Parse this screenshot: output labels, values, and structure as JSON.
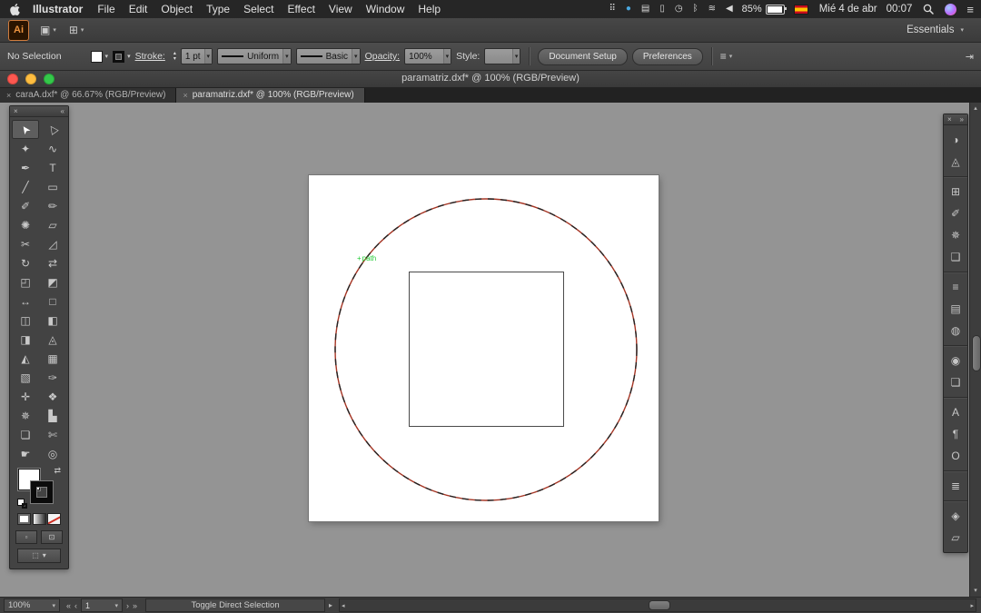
{
  "menubar": {
    "app_name": "Illustrator",
    "menus": [
      "File",
      "Edit",
      "Object",
      "Type",
      "Select",
      "Effect",
      "View",
      "Window",
      "Help"
    ],
    "status_icons": [
      {
        "name": "dropbox-icon",
        "glyph": "⠿"
      },
      {
        "name": "sync-icon",
        "glyph": "●",
        "color": "#4aa8e0"
      },
      {
        "name": "app-indicator-icon",
        "glyph": "▤"
      },
      {
        "name": "display-icon",
        "glyph": "▯"
      },
      {
        "name": "time-machine-icon",
        "glyph": "◷"
      },
      {
        "name": "bluetooth-icon",
        "glyph": "ᛒ"
      },
      {
        "name": "wifi-icon",
        "glyph": "≋"
      },
      {
        "name": "volume-icon",
        "glyph": "◀"
      }
    ],
    "battery_percent": "85%",
    "date_text": "Mié 4 de abr",
    "time_text": "00:07"
  },
  "app_toolbar": {
    "logo_text": "Ai",
    "icons": [
      {
        "name": "bridge-button",
        "glyph": "▣"
      },
      {
        "name": "arrange-documents-button",
        "glyph": "⊞"
      }
    ],
    "workspace_label": "Essentials"
  },
  "control_bar": {
    "selection_label": "No Selection",
    "stroke_label": "Stroke:",
    "stroke_value": "1 pt",
    "width_profile_value": "Uniform",
    "brush_value": "Basic",
    "opacity_label": "Opacity:",
    "opacity_value": "100%",
    "style_label": "Style:",
    "document_setup_label": "Document Setup",
    "preferences_label": "Preferences"
  },
  "titlebar": {
    "title": "paramatriz.dxf* @ 100% (RGB/Preview)"
  },
  "tabs": [
    {
      "label": "caraA.dxf* @ 66.67% (RGB/Preview)",
      "active": false
    },
    {
      "label": "paramatriz.dxf* @ 100% (RGB/Preview)",
      "active": true
    }
  ],
  "tools": [
    {
      "name": "selection-tool",
      "glyph": "➤",
      "rot": -125,
      "active": true
    },
    {
      "name": "direct-selection-tool",
      "glyph": "▷",
      "rot": -125
    },
    {
      "name": "magic-wand-tool",
      "glyph": "✦"
    },
    {
      "name": "lasso-tool",
      "glyph": "∿"
    },
    {
      "name": "pen-tool",
      "glyph": "✒"
    },
    {
      "name": "type-tool",
      "glyph": "T"
    },
    {
      "name": "line-segment-tool",
      "glyph": "╱"
    },
    {
      "name": "rectangle-tool",
      "glyph": "▭"
    },
    {
      "name": "paintbrush-tool",
      "glyph": "✐"
    },
    {
      "name": "pencil-tool",
      "glyph": "✏"
    },
    {
      "name": "blob-brush-tool",
      "glyph": "✺"
    },
    {
      "name": "eraser-tool",
      "glyph": "▱"
    },
    {
      "name": "scissors-tool",
      "glyph": "✂"
    },
    {
      "name": "knife-tool",
      "glyph": "◿"
    },
    {
      "name": "rotate-tool",
      "glyph": "↻"
    },
    {
      "name": "reflect-tool",
      "glyph": "⇄"
    },
    {
      "name": "scale-tool",
      "glyph": "◰"
    },
    {
      "name": "shear-tool",
      "glyph": "◩"
    },
    {
      "name": "width-tool",
      "glyph": "↔"
    },
    {
      "name": "free-transform-tool",
      "glyph": "□"
    },
    {
      "name": "shape-builder-tool",
      "glyph": "◫"
    },
    {
      "name": "live-paint-bucket-tool",
      "glyph": "◧"
    },
    {
      "name": "live-paint-selection-tool",
      "glyph": "◨"
    },
    {
      "name": "perspective-grid-tool",
      "glyph": "◬"
    },
    {
      "name": "perspective-selection-tool",
      "glyph": "◭"
    },
    {
      "name": "mesh-tool",
      "glyph": "▦"
    },
    {
      "name": "gradient-tool",
      "glyph": "▧"
    },
    {
      "name": "eyedropper-tool",
      "glyph": "✑"
    },
    {
      "name": "measure-tool",
      "glyph": "✛"
    },
    {
      "name": "blend-tool",
      "glyph": "❖"
    },
    {
      "name": "symbol-sprayer-tool",
      "glyph": "✵"
    },
    {
      "name": "column-graph-tool",
      "glyph": "▙"
    },
    {
      "name": "artboard-tool",
      "glyph": "❏"
    },
    {
      "name": "slice-tool",
      "glyph": "✄"
    },
    {
      "name": "hand-tool",
      "glyph": "☛"
    },
    {
      "name": "zoom-tool",
      "glyph": "◎"
    }
  ],
  "tool_footer": {
    "color_buttons": [
      {
        "name": "color-button",
        "kind": "color"
      },
      {
        "name": "gradient-button",
        "kind": "gradient"
      },
      {
        "name": "none-button",
        "kind": "none"
      }
    ],
    "mode_buttons": [
      {
        "name": "draw-normal-button",
        "glyph": "▫"
      },
      {
        "name": "draw-behind-button",
        "glyph": "⊡"
      }
    ],
    "screen_mode_glyph": "⬚"
  },
  "right_panel": {
    "groups": [
      [
        {
          "name": "color-panel-icon",
          "glyph": "◑"
        },
        {
          "name": "color-guide-panel-icon",
          "glyph": "◬"
        }
      ],
      [
        {
          "name": "swatches-panel-icon",
          "glyph": "⊞"
        },
        {
          "name": "brushes-panel-icon",
          "glyph": "✐"
        },
        {
          "name": "symbols-panel-icon",
          "glyph": "✵"
        },
        {
          "name": "graphic-styles-panel-icon",
          "glyph": "❑"
        }
      ],
      [
        {
          "name": "stroke-panel-icon",
          "glyph": "≡"
        },
        {
          "name": "gradient-panel-icon",
          "glyph": "▤"
        },
        {
          "name": "transparency-panel-icon",
          "glyph": "◍"
        }
      ],
      [
        {
          "name": "appearance-panel-icon",
          "glyph": "◉"
        },
        {
          "name": "layers-panel-icon",
          "glyph": "❏"
        }
      ],
      [
        {
          "name": "character-panel-icon",
          "glyph": "A"
        },
        {
          "name": "paragraph-panel-icon",
          "glyph": "¶"
        },
        {
          "name": "opentype-panel-icon",
          "glyph": "O"
        }
      ],
      [
        {
          "name": "align-panel-icon",
          "glyph": "≣"
        }
      ],
      [
        {
          "name": "pathfinder-panel-icon",
          "glyph": "◈"
        },
        {
          "name": "transform-panel-icon",
          "glyph": "▱"
        }
      ]
    ]
  },
  "canvas": {
    "path_label": "path",
    "circle_stroke_color": "#a63524",
    "square_stroke_color": "#4a4a4a"
  },
  "statusbar": {
    "zoom": "100%",
    "artboard_number": "1",
    "status_text": "Toggle Direct Selection"
  },
  "icons": {
    "close": "×",
    "collapse_left": "«",
    "collapse_right": "»",
    "caret_down": "▾",
    "caret_up": "▴",
    "nav_first": "«",
    "nav_prev": "‹",
    "nav_next": "›",
    "nav_last": "»",
    "expand_right": "▸",
    "scroll_left": "◂",
    "scroll_right": "▸",
    "swap": "⇄",
    "menu_lines": "≡",
    "anchor_cross": "+",
    "panel_toggle": "⇥"
  }
}
